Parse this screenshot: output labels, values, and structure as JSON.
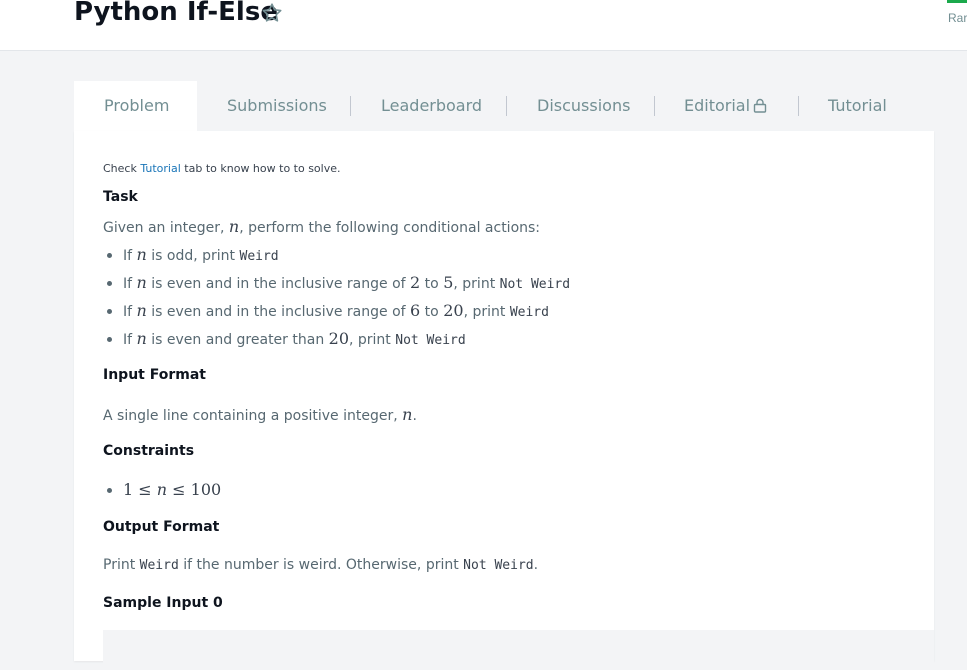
{
  "header": {
    "title": "Python If-Else",
    "rank_label": "Rar"
  },
  "tabs": [
    {
      "label": "Problem",
      "active": true
    },
    {
      "label": "Submissions",
      "active": false
    },
    {
      "label": "Leaderboard",
      "active": false
    },
    {
      "label": "Discussions",
      "active": false
    },
    {
      "label": "Editorial",
      "active": false,
      "icon": "lock-icon"
    },
    {
      "label": "Tutorial",
      "active": false
    }
  ],
  "problem": {
    "note_prefix": "Check ",
    "note_link": "Tutorial",
    "note_suffix": " tab to know how to to solve.",
    "task_heading": "Task",
    "task_intro_pre": "Given an integer, ",
    "task_intro_var": "n",
    "task_intro_post": ", perform the following conditional actions:",
    "rules": [
      {
        "pre": "If ",
        "var": "n",
        "mid": " is odd, print ",
        "code": "Weird"
      },
      {
        "pre": "If ",
        "var": "n",
        "mid": " is even and in the inclusive range of ",
        "a": "2",
        "to": " to ",
        "b": "5",
        "post": ", print ",
        "code": "Not Weird"
      },
      {
        "pre": "If ",
        "var": "n",
        "mid": " is even and in the inclusive range of ",
        "a": "6",
        "to": " to ",
        "b": "20",
        "post": ", print ",
        "code": "Weird"
      },
      {
        "pre": "If ",
        "var": "n",
        "mid": " is even and greater than ",
        "a": "20",
        "post": ", print ",
        "code": "Not Weird"
      }
    ],
    "input_heading": "Input Format",
    "input_text_pre": "A single line containing a positive integer, ",
    "input_text_var": "n",
    "input_text_post": ".",
    "constraints_heading": "Constraints",
    "constraint_low": "1",
    "constraint_le1": " ≤ ",
    "constraint_var": "n",
    "constraint_le2": " ≤ ",
    "constraint_high": "100",
    "output_heading": "Output Format",
    "output_pre": "Print ",
    "output_code1": "Weird",
    "output_mid": " if the number is weird. Otherwise, print ",
    "output_code2": "Not Weird",
    "output_post": ".",
    "sample_heading": "Sample Input 0"
  }
}
